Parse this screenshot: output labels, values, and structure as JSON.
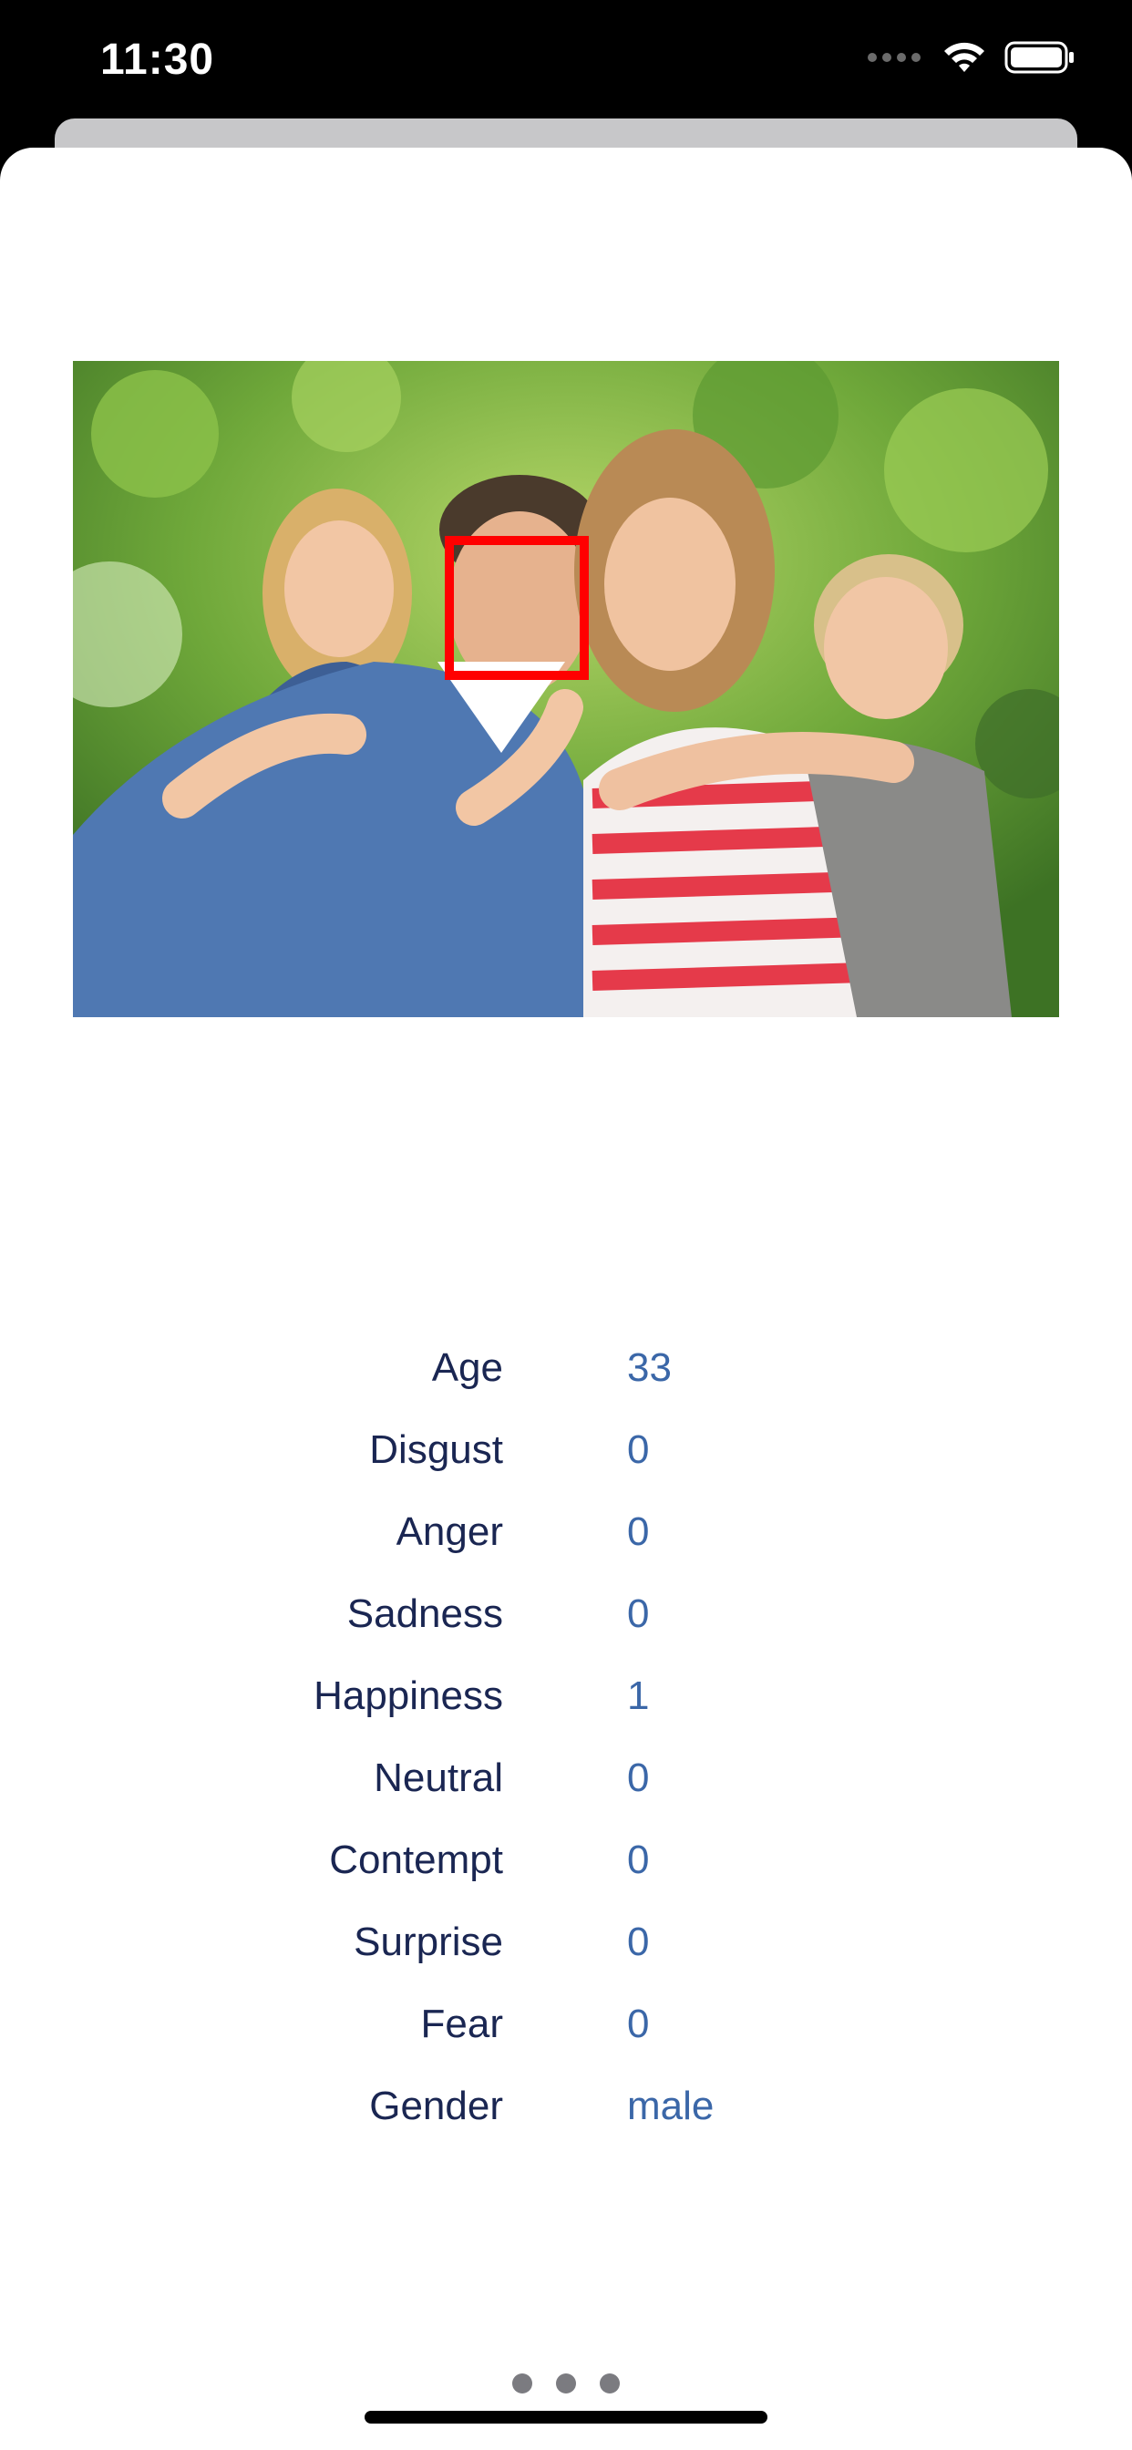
{
  "status_bar": {
    "time": "11:30",
    "icons": [
      "cellular-signal-icon",
      "wifi-icon",
      "battery-icon"
    ]
  },
  "photo": {
    "description_icon": "family-photo",
    "face_box_color": "#ff0000"
  },
  "attributes": [
    {
      "label": "Age",
      "value": "33"
    },
    {
      "label": "Disgust",
      "value": "0"
    },
    {
      "label": "Anger",
      "value": "0"
    },
    {
      "label": "Sadness",
      "value": "0"
    },
    {
      "label": "Happiness",
      "value": "1"
    },
    {
      "label": "Neutral",
      "value": "0"
    },
    {
      "label": "Contempt",
      "value": "0"
    },
    {
      "label": "Surprise",
      "value": "0"
    },
    {
      "label": "Fear",
      "value": "0"
    },
    {
      "label": "Gender",
      "value": "male"
    }
  ],
  "colors": {
    "label": "#1a2652",
    "value": "#3b67a8",
    "sheet": "#ffffff",
    "status_bar": "#000000"
  },
  "pager": {
    "count": 3
  }
}
